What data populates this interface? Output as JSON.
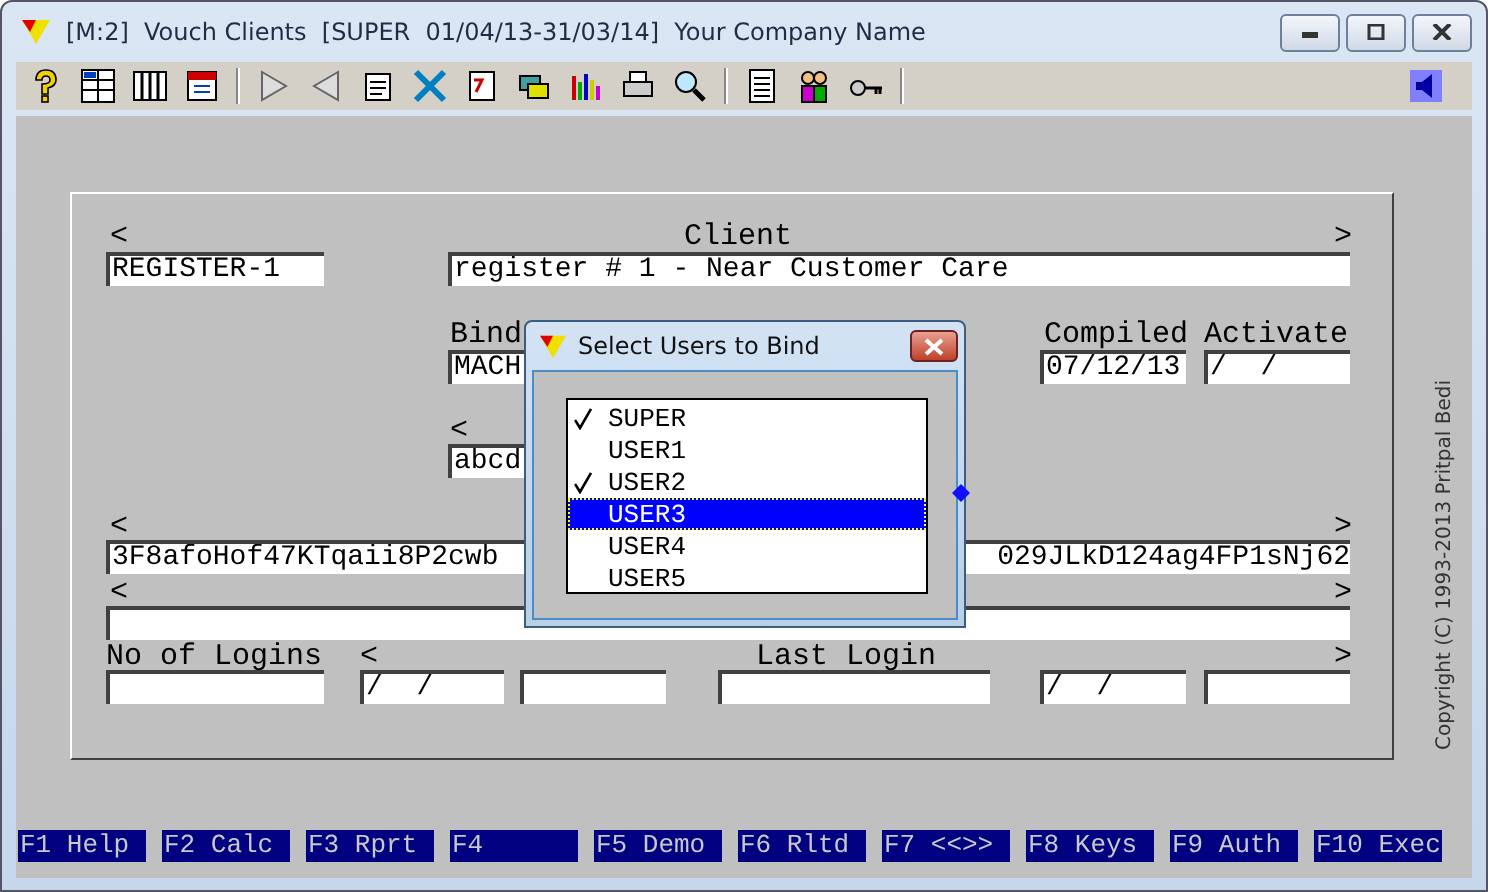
{
  "window": {
    "title": "[M:2]  Vouch Clients  [SUPER  01/04/13-31/03/14]  Your Company Name"
  },
  "form": {
    "items": [
      {
        "kind": "label",
        "text": "<"
      },
      {
        "kind": "label",
        "text": "Client"
      },
      {
        "kind": "label",
        "text": ">"
      },
      {
        "kind": "field",
        "value": "REGISTER-1"
      },
      {
        "kind": "field",
        "value": "register # 1 - Near Customer Care"
      },
      {
        "kind": "label",
        "text": "Bind"
      },
      {
        "kind": "label",
        "text": "Compiled"
      },
      {
        "kind": "label",
        "text": "Activate"
      },
      {
        "kind": "field",
        "value": "MACH"
      },
      {
        "kind": "field",
        "value": "07/12/13"
      },
      {
        "kind": "field",
        "value": "/  /"
      },
      {
        "kind": "label",
        "text": "<"
      },
      {
        "kind": "field",
        "value": "abcd"
      },
      {
        "kind": "label",
        "text": "<"
      },
      {
        "kind": "label",
        "text": ">"
      },
      {
        "kind": "field",
        "value": "3F8afoHof47KTqaii8P2cwb",
        "value_right": "029JLkD124ag4FP1sNj62"
      },
      {
        "kind": "label",
        "text": "<"
      },
      {
        "kind": "label",
        "text": ">"
      },
      {
        "kind": "field"
      },
      {
        "kind": "label",
        "text": "No of Logins"
      },
      {
        "kind": "label",
        "text": "<"
      },
      {
        "kind": "label",
        "text": "Last Login"
      },
      {
        "kind": "label",
        "text": ">"
      },
      {
        "kind": "field"
      },
      {
        "kind": "field",
        "value": "/  /"
      },
      {
        "kind": "field"
      },
      {
        "kind": "field"
      },
      {
        "kind": "field",
        "value": "/  /"
      },
      {
        "kind": "field"
      }
    ]
  },
  "dialog": {
    "title": "Select Users to Bind",
    "items": [
      {
        "label": "SUPER",
        "checked": true,
        "selected": false
      },
      {
        "label": "USER1",
        "checked": false,
        "selected": false
      },
      {
        "label": "USER2",
        "checked": true,
        "selected": false
      },
      {
        "label": "USER3",
        "checked": false,
        "selected": true
      },
      {
        "label": "USER4",
        "checked": false,
        "selected": false
      },
      {
        "label": "USER5",
        "checked": false,
        "selected": false
      }
    ]
  },
  "copyright": "Copyright (C) 1993-2013 Pritpal Bedi",
  "function_keys": [
    "F1 Help",
    "F2 Calc",
    "F3 Rprt",
    "F4",
    "F5 Demo",
    "F6 Rltd",
    "F7 <<>>",
    "F8 Keys",
    "F9 Auth",
    "F10 Exec"
  ]
}
